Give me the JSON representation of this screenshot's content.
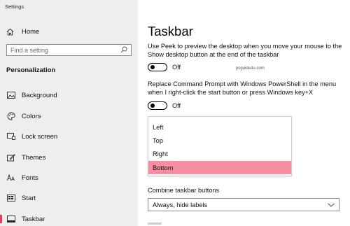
{
  "app": {
    "title": "Settings"
  },
  "sidebar": {
    "home_label": "Home",
    "search_placeholder": "Find a setting",
    "section_header": "Personalization",
    "items": [
      {
        "label": "Background",
        "icon": "image-icon"
      },
      {
        "label": "Colors",
        "icon": "palette-icon"
      },
      {
        "label": "Lock screen",
        "icon": "lock-screen-icon"
      },
      {
        "label": "Themes",
        "icon": "themes-icon"
      },
      {
        "label": "Fonts",
        "icon": "fonts-icon"
      },
      {
        "label": "Start",
        "icon": "start-icon"
      },
      {
        "label": "Taskbar",
        "icon": "taskbar-icon",
        "selected": true
      }
    ],
    "accent_color": "#e23c5a"
  },
  "main": {
    "title": "Taskbar",
    "peek_text": "Use Peek to preview the desktop when you move your mouse to the Show desktop button at the end of the taskbar",
    "peek_toggle": {
      "state": "Off"
    },
    "watermark": "pcguide4u.com",
    "powershell_text": "Replace Command Prompt with Windows PowerShell in the menu when I right-click the start button or press Windows key+X",
    "powershell_toggle": {
      "state": "Off"
    },
    "location_dropdown": {
      "options": [
        "Left",
        "Top",
        "Right",
        "Bottom"
      ],
      "selected": "Bottom",
      "selected_color": "#f58ea3"
    },
    "combine_label": "Combine taskbar buttons",
    "combine_value": "Always, hide labels"
  }
}
